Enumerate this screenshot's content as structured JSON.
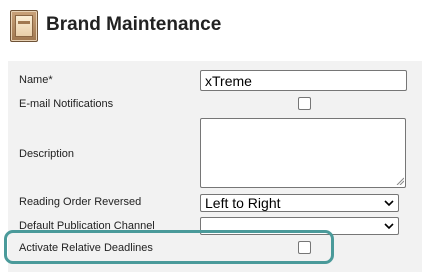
{
  "header": {
    "title": "Brand Maintenance",
    "icon": "brand-folder-icon"
  },
  "form": {
    "name": {
      "label": "Name*",
      "value": "xTreme"
    },
    "email_notifications": {
      "label": "E-mail Notifications",
      "checked": false
    },
    "description": {
      "label": "Description",
      "value": ""
    },
    "reading_order": {
      "label": "Reading Order Reversed",
      "selected": "Left to Right"
    },
    "publication_channel": {
      "label": "Default Publication Channel",
      "selected": ""
    },
    "relative_deadlines": {
      "label": "Activate Relative Deadlines",
      "checked": false
    }
  },
  "highlight_color": "#4a9a9a"
}
